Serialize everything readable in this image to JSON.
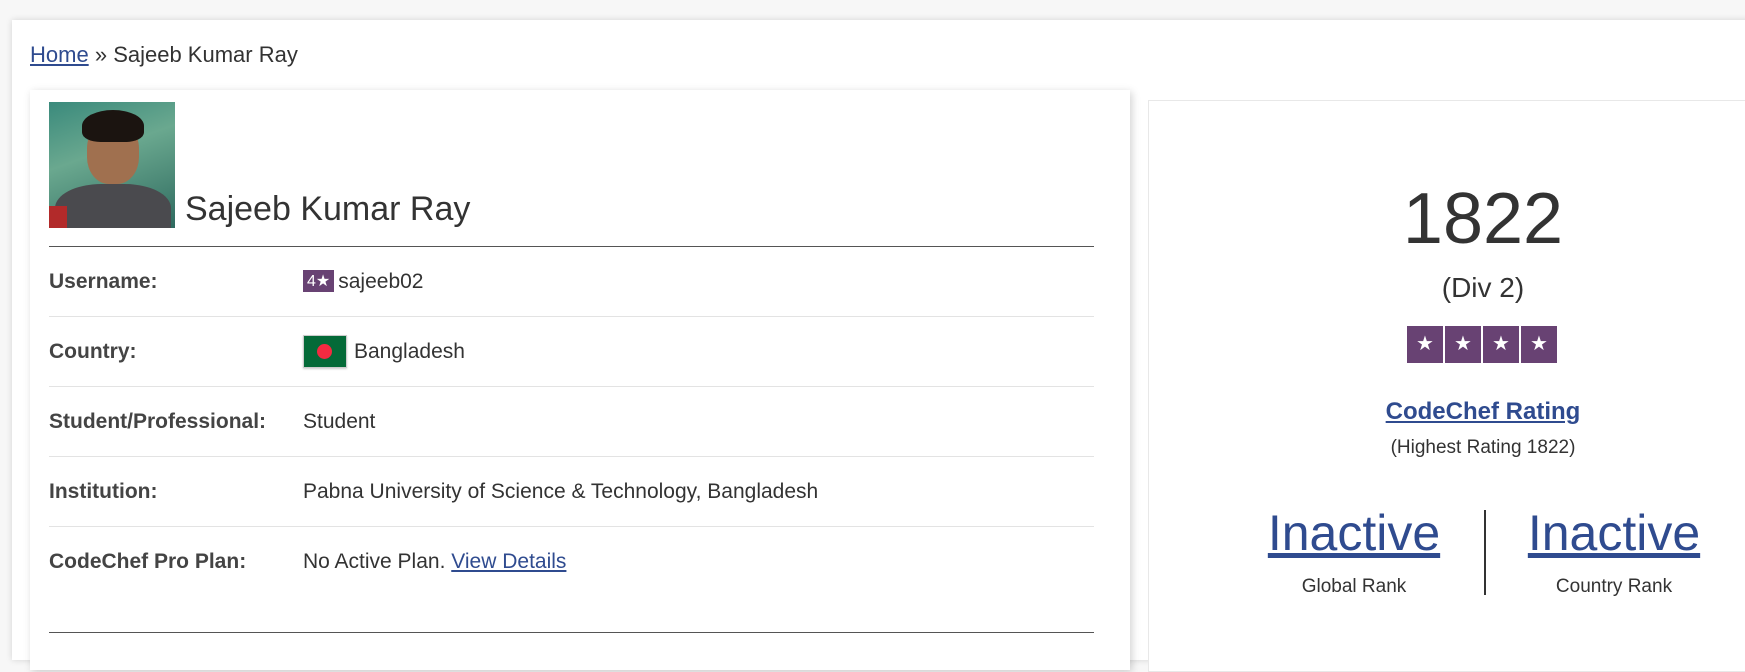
{
  "breadcrumb": {
    "home": "Home",
    "separator": "»",
    "current": "Sajeeb Kumar Ray"
  },
  "profile": {
    "name": "Sajeeb Kumar Ray",
    "fields": {
      "username_label": "Username:",
      "username_stars": "4★",
      "username": "sajeeb02",
      "country_label": "Country:",
      "country": "Bangladesh",
      "status_label": "Student/Professional:",
      "status": "Student",
      "institution_label": "Institution:",
      "institution": "Pabna University of Science & Technology, Bangladesh",
      "plan_label": "CodeChef Pro Plan:",
      "plan": "No Active Plan.",
      "plan_link": "View Details"
    }
  },
  "rating": {
    "value": "1822",
    "division": "(Div 2)",
    "star_count": 4,
    "star_glyph": "★",
    "link_label": "CodeChef Rating",
    "highest": "(Highest Rating 1822)",
    "global_rank": "Inactive",
    "global_rank_label": "Global Rank",
    "country_rank": "Inactive",
    "country_rank_label": "Country Rank"
  },
  "colors": {
    "link": "#2f4b8f",
    "star_badge": "#684273",
    "flag_green": "#046a38",
    "flag_red": "#f42a41"
  }
}
